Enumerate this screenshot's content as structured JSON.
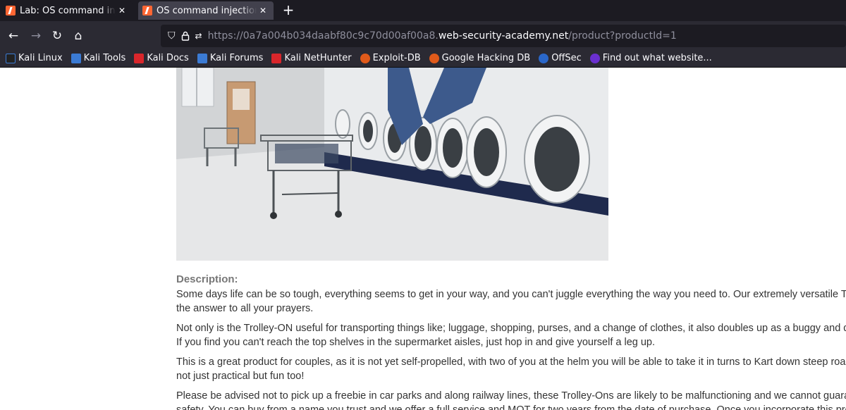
{
  "browser": {
    "tabs": [
      {
        "title": "Lab: OS command injection",
        "close": "✕"
      },
      {
        "title": "OS command injection, si",
        "close": "✕"
      }
    ],
    "new_tab": "+",
    "url_prefix": "https://0a7a004b034daabf80c9c70d00af00a8.",
    "url_domain": "web-security-academy.net",
    "url_path": "/product?productId=1",
    "bookmarks": [
      {
        "label": "Kali Linux",
        "color": "#3b7bd4"
      },
      {
        "label": "Kali Tools",
        "color": "#3b7bd4"
      },
      {
        "label": "Kali Docs",
        "color": "#d9262b"
      },
      {
        "label": "Kali Forums",
        "color": "#3b7bd4"
      },
      {
        "label": "Kali NetHunter",
        "color": "#d9262b"
      },
      {
        "label": "Exploit-DB",
        "color": "#e05a1a"
      },
      {
        "label": "Google Hacking DB",
        "color": "#e05a1a"
      },
      {
        "label": "OffSec",
        "color": "#2a67c9"
      },
      {
        "label": "Find out what website...",
        "color": "#6a2fcf"
      }
    ]
  },
  "page": {
    "description_label": "Description:",
    "paragraphs": [
      [
        "Some days life can be so tough, everything seems to get in your way, and you can't juggle everything the way you need to. Our extremely versatile Trolley",
        "the answer to all your prayers."
      ],
      [
        "Not only is the Trolley-ON useful for transporting things like; luggage, shopping, purses, and a change of clothes, it also doubles up as a buggy and dog ba",
        "If you find you can't reach the top shelves in the supermarket aisles, just hop in and give yourself a leg up."
      ],
      [
        "This is a great product for couples, as it is not yet self-propelled, with two of you at the helm you will be able to take it in turns to Kart down steep roads an",
        "not just practical but fun too!"
      ],
      [
        "Please be advised not to pick up a freebie in car parks and along railway lines, these Trolley-Ons are likely to be malfunctioning and we cannot guarantee",
        "safety. You can buy from a name you trust and we offer a full service and MOT for two years from the date of purchase. Once you incorporate this product"
      ]
    ]
  }
}
